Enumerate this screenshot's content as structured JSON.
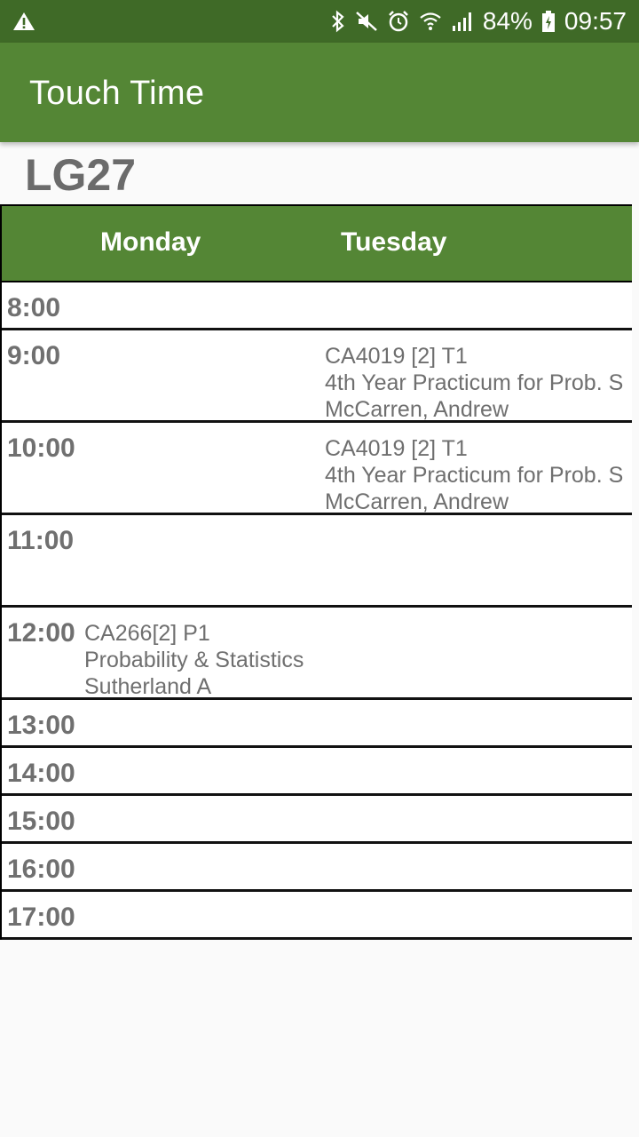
{
  "status_bar": {
    "warning_icon": "warning-icon",
    "icons": [
      "bluetooth-icon",
      "mute-icon",
      "alarm-icon",
      "wifi-icon",
      "signal-icon"
    ],
    "battery": "84%",
    "battery_icon": "battery-charging-icon",
    "time": "09:57"
  },
  "app_bar": {
    "title": "Touch Time"
  },
  "room": "LG27",
  "timetable": {
    "days": [
      "Monday",
      "Tuesday"
    ],
    "rows": [
      {
        "time": "8:00",
        "monday": null,
        "tuesday": null
      },
      {
        "time": "9:00",
        "monday": null,
        "tuesday": {
          "code": "CA4019 [2] T1",
          "title": "4th Year Practicum for Prob. S",
          "lecturer": "McCarren, Andrew"
        }
      },
      {
        "time": "10:00",
        "monday": null,
        "tuesday": {
          "code": "CA4019 [2] T1",
          "title": "4th Year Practicum for Prob. S",
          "lecturer": "McCarren, Andrew"
        }
      },
      {
        "time": "11:00",
        "monday": null,
        "tuesday": null
      },
      {
        "time": "12:00",
        "monday": {
          "code": "CA266[2] P1",
          "title": "Probability & Statistics",
          "lecturer": "Sutherland A"
        },
        "tuesday": null
      },
      {
        "time": "13:00",
        "monday": null,
        "tuesday": null
      },
      {
        "time": "14:00",
        "monday": null,
        "tuesday": null
      },
      {
        "time": "15:00",
        "monday": null,
        "tuesday": null
      },
      {
        "time": "16:00",
        "monday": null,
        "tuesday": null
      },
      {
        "time": "17:00",
        "monday": null,
        "tuesday": null
      }
    ]
  },
  "colors": {
    "status_bar": "#3f6a27",
    "accent": "#548635",
    "background": "#fafafa",
    "text_gray": "#707070"
  }
}
